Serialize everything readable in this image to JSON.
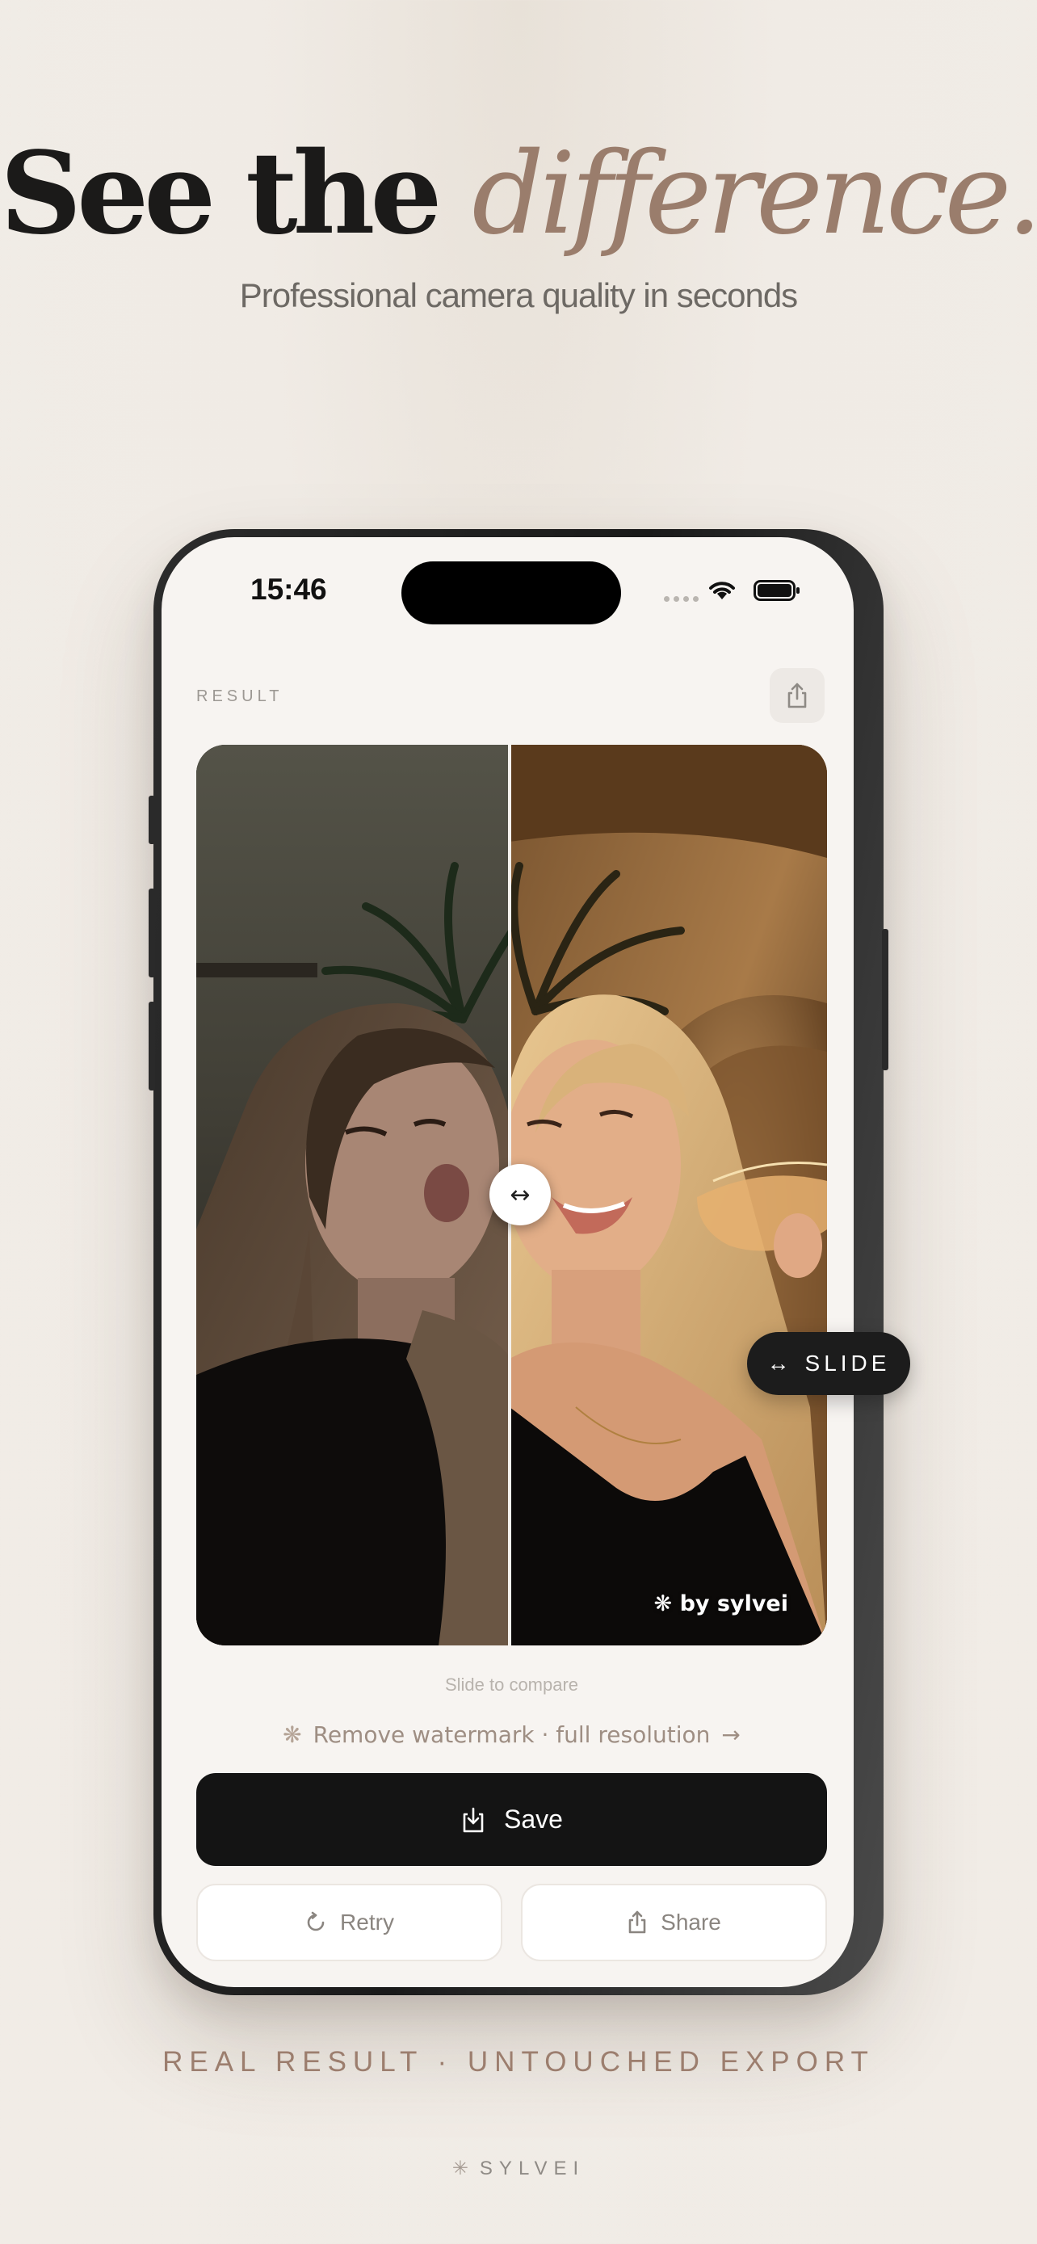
{
  "headline": {
    "prefix": "See the ",
    "accent": "difference."
  },
  "subheadline": "Professional camera quality in seconds",
  "phone": {
    "status_bar": {
      "time": "15:46"
    },
    "header": {
      "label": "RESULT"
    },
    "compare": {
      "watermark": "❋ by sylvei",
      "slider_position": 0.5
    },
    "slide_hint": "Slide to compare",
    "upsell": {
      "text": "Remove watermark · full resolution"
    },
    "buttons": {
      "save": "Save",
      "retry": "Retry",
      "share": "Share"
    },
    "slide_pill": {
      "label": "SLIDE"
    }
  },
  "footer": {
    "tagline": "REAL RESULT · UNTOUCHED EXPORT",
    "brand": "SYLVEI"
  },
  "icons": {
    "share": "share-icon",
    "drag_handle": "horizontal-arrows-icon",
    "download": "download-icon",
    "retry": "refresh-icon",
    "sparkle": "sparkle-icon",
    "arrow": "arrow-right-icon"
  },
  "colors": {
    "accent": "#9a7d6c",
    "primary_button": "#141414",
    "background": "#f1ece6"
  }
}
